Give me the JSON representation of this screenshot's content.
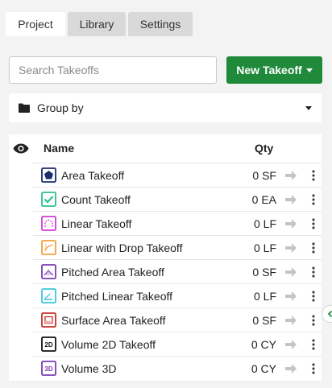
{
  "tabs": [
    {
      "label": "Project",
      "active": true
    },
    {
      "label": "Library",
      "active": false
    },
    {
      "label": "Settings",
      "active": false
    }
  ],
  "search": {
    "placeholder": "Search Takeoffs",
    "value": ""
  },
  "new_takeoff": {
    "label": "New Takeoff",
    "color": "#1f8a3a"
  },
  "group_by": {
    "label": "Group by",
    "icon": "folder-icon"
  },
  "table": {
    "headers": {
      "visibility_icon": "eye-icon",
      "name": "Name",
      "qty": "Qty"
    },
    "rows": [
      {
        "icon": "area-takeoff-icon",
        "color": "#1a2f6b",
        "name": "Area Takeoff",
        "qty": "0 SF"
      },
      {
        "icon": "count-takeoff-icon",
        "color": "#2fbf8f",
        "name": "Count Takeoff",
        "qty": "0 EA"
      },
      {
        "icon": "linear-takeoff-icon",
        "color": "#d23ad6",
        "name": "Linear Takeoff",
        "qty": "0 LF"
      },
      {
        "icon": "linear-drop-takeoff-icon",
        "color": "#f0a03a",
        "name": "Linear with Drop Takeoff",
        "qty": "0 LF"
      },
      {
        "icon": "pitched-area-takeoff-icon",
        "color": "#7a3db0",
        "name": "Pitched Area Takeoff",
        "qty": "0 SF"
      },
      {
        "icon": "pitched-linear-takeoff-icon",
        "color": "#3cc6dd",
        "name": "Pitched Linear Takeoff",
        "qty": "0 LF"
      },
      {
        "icon": "surface-area-takeoff-icon",
        "color": "#c8302c",
        "name": "Surface Area Takeoff",
        "qty": "0 SF"
      },
      {
        "icon": "volume-2d-takeoff-icon",
        "color": "#111111",
        "name": "Volume 2D Takeoff",
        "qty": "0 CY",
        "badge": "2D"
      },
      {
        "icon": "volume-3d-icon",
        "color": "#7a3db0",
        "name": "Volume 3D",
        "qty": "0 CY",
        "badge": "3D"
      }
    ]
  },
  "edge_toggle": {
    "icon": "chevron-left-icon"
  }
}
